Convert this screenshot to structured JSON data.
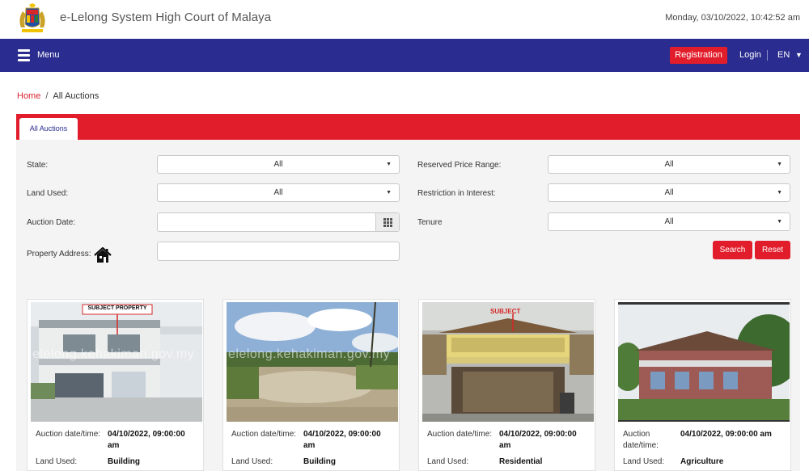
{
  "header": {
    "site_title": "e-Lelong System High Court of Malaya",
    "datetime": "Monday, 03/10/2022, 10:42:52 am"
  },
  "navbar": {
    "menu_label": "Menu",
    "registration_label": "Registration",
    "login_label": "Login",
    "language": "EN",
    "accent_color": "#e21d2b",
    "bar_color": "#2a2d8f"
  },
  "breadcrumb": {
    "home": "Home",
    "separator": "/",
    "current": "All Auctions"
  },
  "tabs": [
    {
      "label": "All Auctions",
      "active": true
    }
  ],
  "filters": {
    "state": {
      "label": "State:",
      "value": "All"
    },
    "land_used": {
      "label": "Land Used:",
      "value": "All"
    },
    "auction_date": {
      "label": "Auction Date:",
      "value": ""
    },
    "property_address": {
      "label": "Property Address:",
      "value": ""
    },
    "reserved_price_range": {
      "label": "Reserved Price Range:",
      "value": "All"
    },
    "restriction_in_interest": {
      "label": "Restriction in Interest:",
      "value": "All"
    },
    "tenure": {
      "label": "Tenure",
      "value": "All"
    },
    "search_label": "Search",
    "reset_label": "Reset"
  },
  "listings": [
    {
      "photo_caption": "SUBJECT PROPERTY",
      "watermark": "elelong.kehakiman.gov.my",
      "date_label": "Auction date/time:",
      "date_line1": "04/10/2022, 09:00:00",
      "date_line2": "am",
      "land_label": "Land Used:",
      "land_value": "Building"
    },
    {
      "photo_caption": "",
      "watermark": "elelong.kehakiman.gov.my",
      "date_label": "Auction date/time:",
      "date_line1": "04/10/2022, 09:00:00",
      "date_line2": "am",
      "land_label": "Land Used:",
      "land_value": "Building"
    },
    {
      "photo_caption": "SUBJECT",
      "watermark": "",
      "date_label": "Auction date/time:",
      "date_line1": "04/10/2022, 09:00:00",
      "date_line2": "am",
      "land_label": "Land Used:",
      "land_value": "Residential"
    },
    {
      "photo_caption": "",
      "watermark": "",
      "date_label_line1": "Auction",
      "date_label_line2": "date/time:",
      "date_line1": "04/10/2022, 09:00:00 am",
      "land_label": "Land Used:",
      "land_value": "Agriculture"
    }
  ]
}
